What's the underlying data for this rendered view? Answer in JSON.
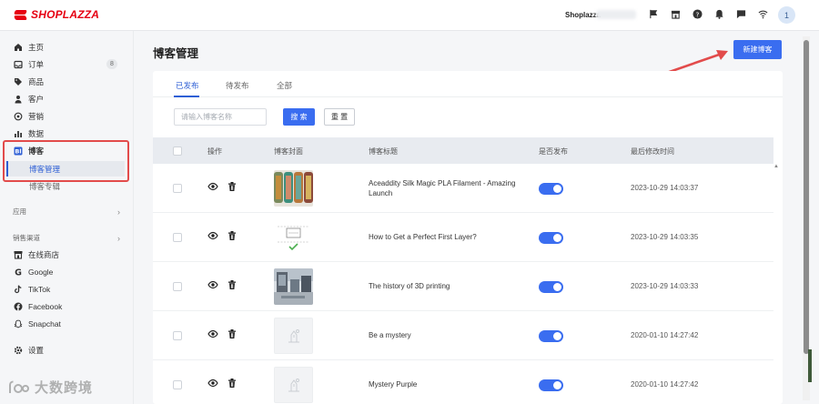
{
  "brand": {
    "name": "SHOPLAZZA"
  },
  "topbar": {
    "shop_name": "Shoplazza",
    "user_initial": "1"
  },
  "sidebar": {
    "home": "主页",
    "orders": "订单",
    "orders_badge": "8",
    "products": "商品",
    "customers": "客户",
    "marketing": "营销",
    "analytics": "数据",
    "blog": "博客",
    "blog_manage": "博客管理",
    "blog_column": "博客专辑",
    "apps": "应用",
    "sales_channels": "销售渠道",
    "online_store": "在线商店",
    "google": "Google",
    "tiktok": "TikTok",
    "facebook": "Facebook",
    "snapchat": "Snapchat",
    "settings": "设置"
  },
  "main": {
    "title": "博客管理",
    "new_button": "新建博客",
    "tabs": [
      "已发布",
      "待发布",
      "全部"
    ],
    "search_placeholder": "请输入博客名称",
    "search_button": "搜 索",
    "reset_button": "重 置",
    "columns": {
      "op": "操作",
      "cover": "博客封面",
      "title": "博客标题",
      "published": "是否发布",
      "modified": "最后修改时间"
    },
    "rows": [
      {
        "title": "Aceaddity Silk Magic PLA Filament - Amazing Launch",
        "published": true,
        "modified": "2023-10-29 14:03:37"
      },
      {
        "title": "How to Get a Perfect First Layer?",
        "published": true,
        "modified": "2023-10-29 14:03:35"
      },
      {
        "title": "The history of 3D printing",
        "published": true,
        "modified": "2023-10-29 14:03:33"
      },
      {
        "title": "Be a mystery",
        "published": true,
        "modified": "2020-01-10 14:27:42"
      },
      {
        "title": "Mystery Purple",
        "published": true,
        "modified": "2020-01-10 14:27:42"
      }
    ]
  },
  "watermark": {
    "text": "大数跨境"
  },
  "colors": {
    "accent": "#3a6df0",
    "brand": "#e60012",
    "highlight": "#e24b4b"
  }
}
